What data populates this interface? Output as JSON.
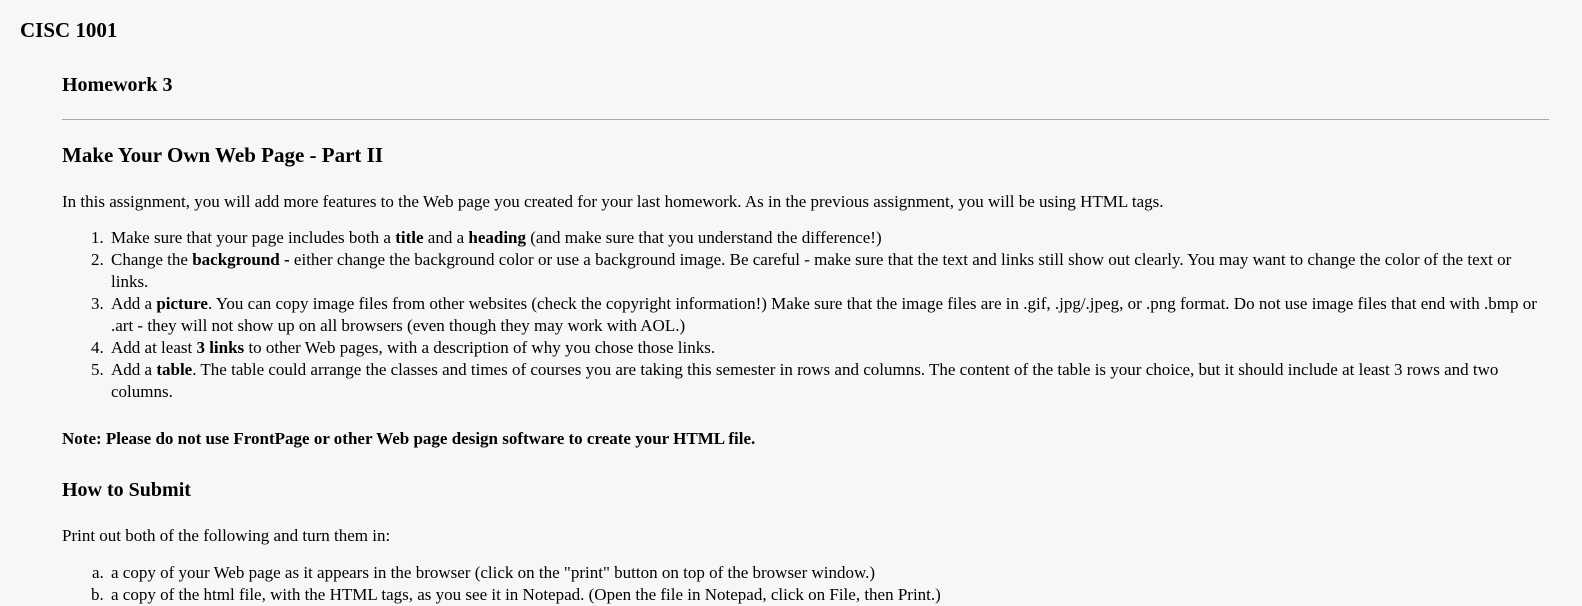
{
  "document": {
    "course_title": "CISC 1001",
    "assignment_title": "Homework 3",
    "section_title": "Make Your Own Web Page - Part II",
    "intro_paragraph": "In this assignment, you will add more features to the Web page you created for your last homework. As in the previous assignment, you will be using HTML tags.",
    "requirements": [
      {
        "pre": "Make sure that your page includes both a ",
        "bold1": "title",
        "mid": " and a ",
        "bold2": "heading",
        "post": " (and make sure that you understand the difference!)"
      },
      {
        "pre": "Change the ",
        "bold1": "background -",
        "mid": "",
        "bold2": "",
        "post": " either change the background color or use a background image. Be careful - make sure that the text and links still show out clearly. You may want to change the color of the text or links."
      },
      {
        "pre": "Add a ",
        "bold1": "picture",
        "mid": "",
        "bold2": "",
        "post": ". You can copy image files from other websites (check the copyright information!) Make sure that the image files are in .gif, .jpg/.jpeg, or .png format. Do not use image files that end with .bmp or .art - they will not show up on all browsers (even though they may work with AOL.)"
      },
      {
        "pre": "Add at least ",
        "bold1": "3 links",
        "mid": "",
        "bold2": "",
        "post": " to other Web pages, with a description of why you chose those links."
      },
      {
        "pre": "Add a ",
        "bold1": "table",
        "mid": "",
        "bold2": "",
        "post": ". The table could arrange the classes and times of courses you are taking this semester in rows and columns. The content of the table is your choice, but it should include at least 3 rows and two columns."
      }
    ],
    "note": "Note: Please do not use FrontPage or other Web page design software to create your HTML file.",
    "submit_title": "How to Submit",
    "submit_intro": "Print out both of the following and turn them in:",
    "submit_items": [
      "a copy of your Web page as it appears in the browser (click on the \"print\" button on top of the browser window.)",
      "a copy of the html file, with the HTML tags, as you see it in Notepad. (Open the file in Notepad, click on File, then Print.)"
    ]
  }
}
